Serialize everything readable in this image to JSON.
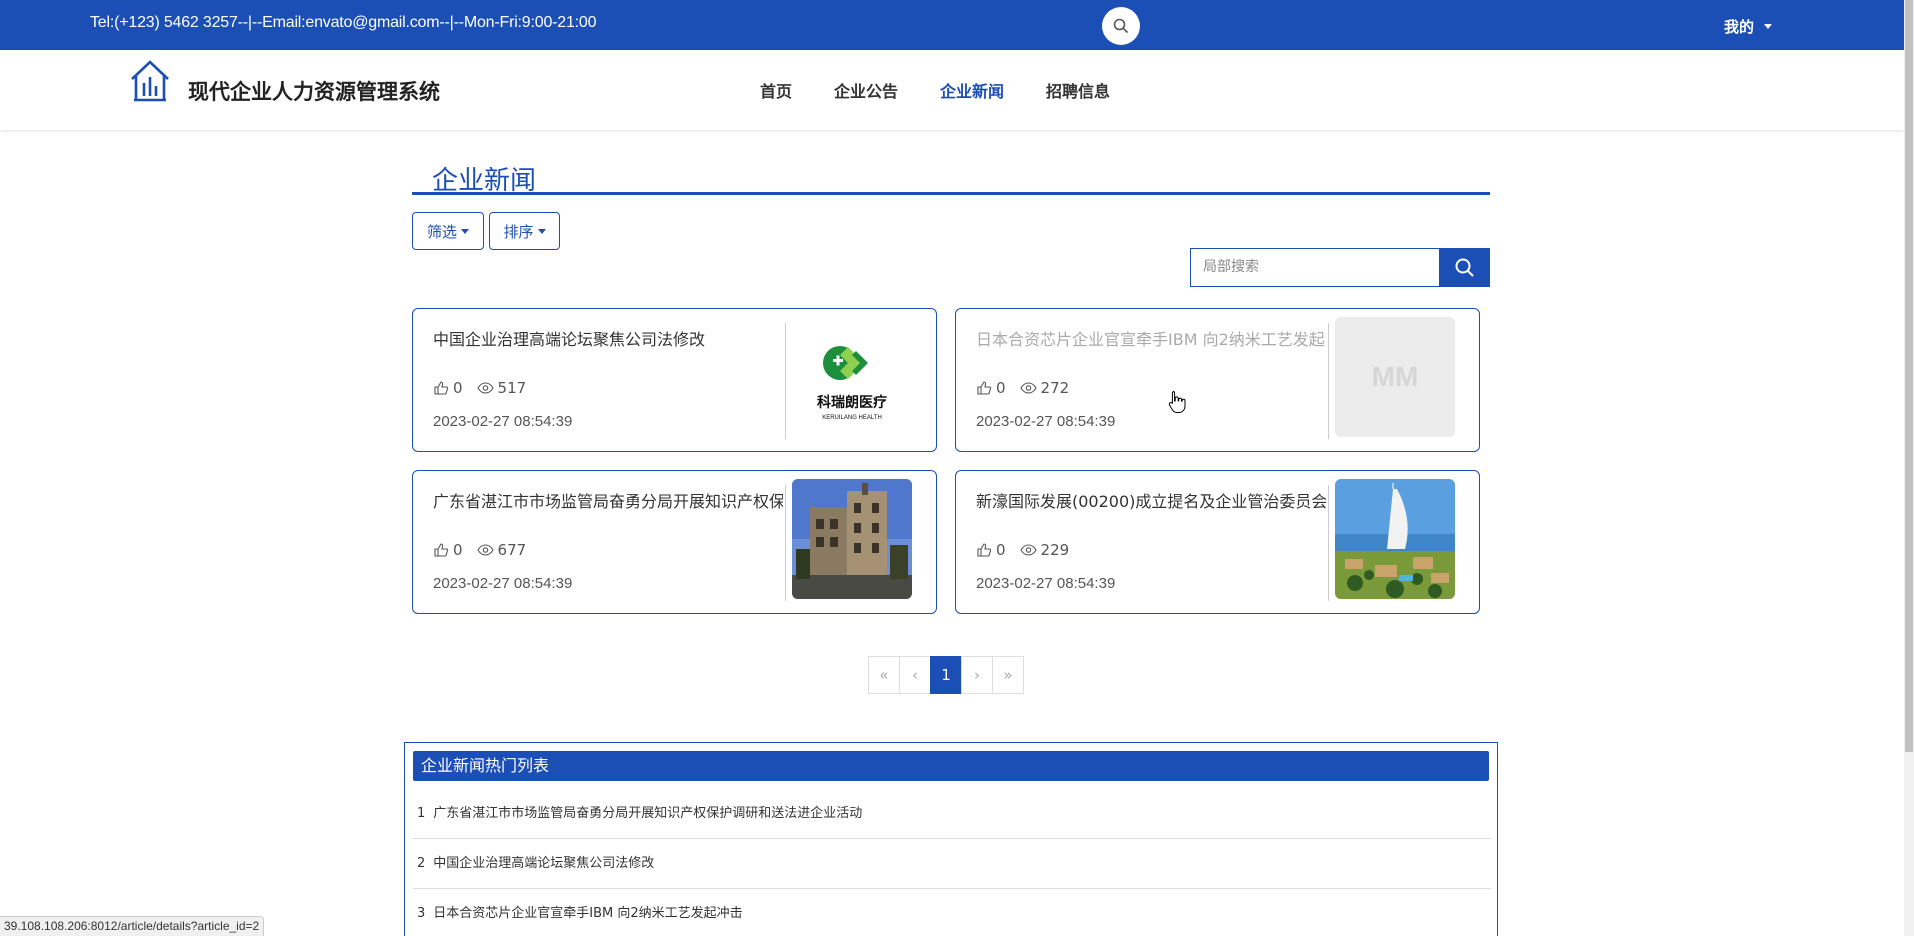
{
  "topbar": {
    "contact": "Tel:(+123) 5462 3257--|--Email:envato@gmail.com--|--Mon-Fri:9:00-21:00",
    "user_menu": "我的"
  },
  "header": {
    "brand": "现代企业人力资源管理系统",
    "nav": [
      {
        "label": "首页",
        "active": false
      },
      {
        "label": "企业公告",
        "active": false
      },
      {
        "label": "企业新闻",
        "active": true
      },
      {
        "label": "招聘信息",
        "active": false
      }
    ]
  },
  "page": {
    "title": "企业新闻",
    "filter_label": "筛选",
    "sort_label": "排序",
    "search_placeholder": "局部搜索"
  },
  "articles": [
    {
      "title": "中国企业治理高端论坛聚焦公司法修改",
      "likes": "0",
      "views": "517",
      "date": "2023-02-27 08:54:39",
      "thumb": "logo-kerui"
    },
    {
      "title": "日本合资芯片企业官宣牵手IBM 向2纳米工艺发起冲击",
      "likes": "0",
      "views": "272",
      "date": "2023-02-27 08:54:39",
      "thumb": "placeholder",
      "thumb_text": "MM"
    },
    {
      "title": "广东省湛江市市场监管局奋勇分局开展知识产权保护调研和送法进企业活动",
      "likes": "0",
      "views": "677",
      "date": "2023-02-27 08:54:39",
      "thumb": "building-photo"
    },
    {
      "title": "新濠国际发展(00200)成立提名及企业管治委员会",
      "likes": "0",
      "views": "229",
      "date": "2023-02-27 08:54:39",
      "thumb": "resort-photo"
    }
  ],
  "pagination": {
    "first": "«",
    "prev": "‹",
    "current": "1",
    "next": "›",
    "last": "»"
  },
  "hot_list": {
    "title": "企业新闻热门列表",
    "items": [
      {
        "num": "1",
        "title": "广东省湛江市市场监管局奋勇分局开展知识产权保护调研和送法进企业活动"
      },
      {
        "num": "2",
        "title": "中国企业治理高端论坛聚焦公司法修改"
      },
      {
        "num": "3",
        "title": "日本合资芯片企业官宣牵手IBM 向2纳米工艺发起冲击"
      }
    ]
  },
  "statusbar": "39.108.108.206:8012/article/details?article_id=2",
  "colors": {
    "primary": "#1c4fb5"
  }
}
